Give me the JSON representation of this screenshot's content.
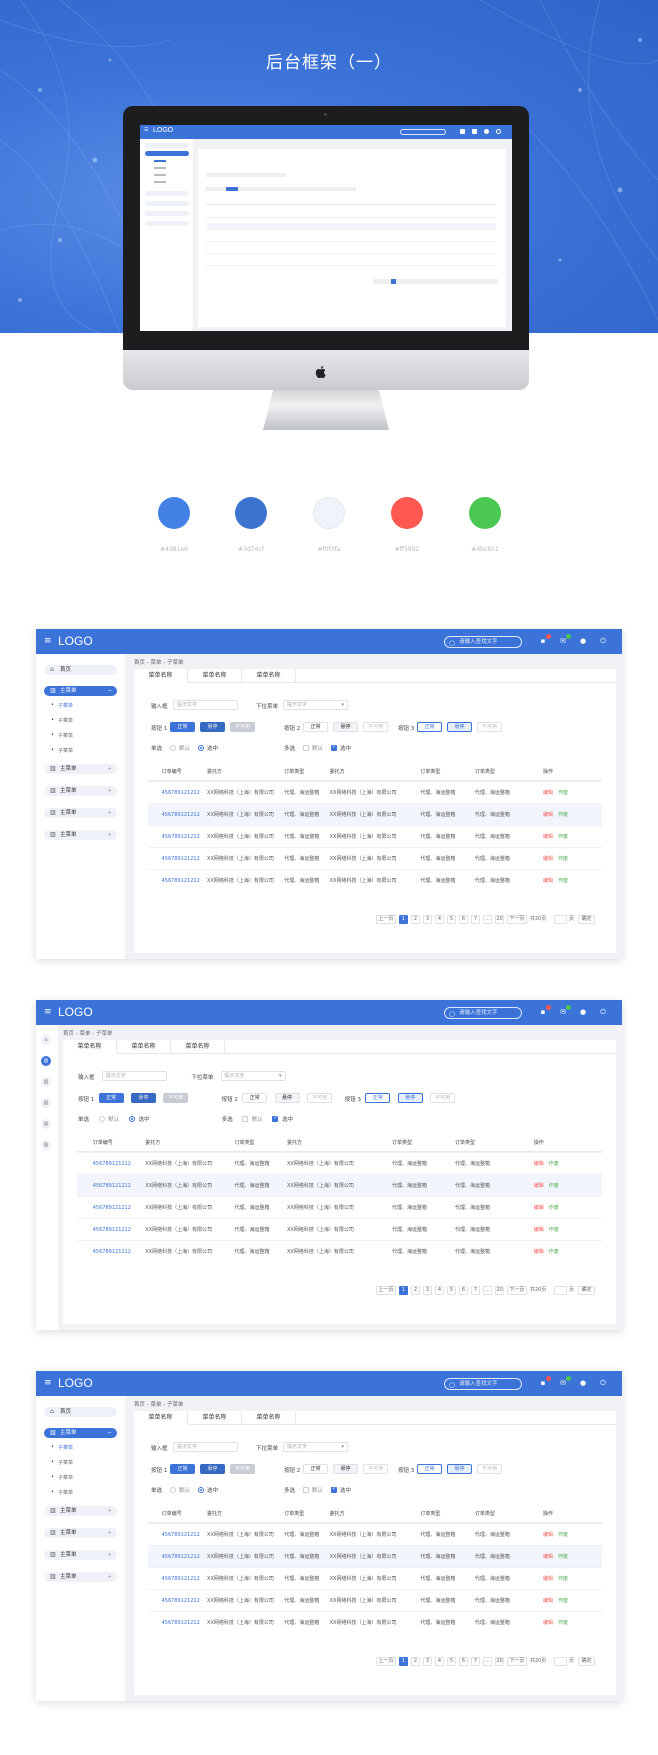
{
  "hero": {
    "title": "后台框架（一）",
    "colors": {
      "bg": "#3d74d9"
    }
  },
  "palette": [
    {
      "hex": "#4381e6",
      "label": "#4381e6"
    },
    {
      "hex": "#3d74cf",
      "label": "#3d74cf"
    },
    {
      "hex": "#f0f3fa",
      "label": "#f0f3fa"
    },
    {
      "hex": "#ff5952",
      "label": "#ff5952"
    },
    {
      "hex": "#4bc851",
      "label": "#4bc851"
    }
  ],
  "app": {
    "logo": "LOGO",
    "search_placeholder": "请输入查找文字",
    "breadcrumb": "首页 - 菜单 - 子菜单",
    "tabs": [
      "菜单名称",
      "菜单名称",
      "菜单名称"
    ],
    "sidebar": {
      "home": "首页",
      "main_active": "主菜单",
      "subs": [
        "子菜单",
        "子菜单",
        "子菜单",
        "子菜单"
      ],
      "mains": [
        "主菜单",
        "主菜单",
        "主菜单",
        "主菜单"
      ]
    },
    "form": {
      "input_label": "输入框",
      "input_placeholder": "提示文字",
      "select_label": "下拉菜单",
      "select_placeholder": "提示文字",
      "btngroup1": "按钮 1",
      "btngroup2": "按钮 2",
      "btngroup3": "按钮 3",
      "btn_normal": "正常",
      "btn_hover": "悬停",
      "btn_disabled": "不可用",
      "radio_label": "单选",
      "check_label": "多选",
      "opt_default": "默认",
      "opt_selected": "选中"
    },
    "table": {
      "headers": [
        "订单编号",
        "委托方",
        "订单类型",
        "委托方",
        "订单类型",
        "订单类型",
        "操作"
      ],
      "rows": [
        [
          "456789121212",
          "XX网络科技（上海）有限公司",
          "代理、海运整箱",
          "XX网络科技（上海）有限公司",
          "代理、海运整箱",
          "代理、海运整箱"
        ],
        [
          "456789121212",
          "XX网络科技（上海）有限公司",
          "代理、海运整箱",
          "XX网络科技（上海）有限公司",
          "代理、海运整箱",
          "代理、海运整箱"
        ],
        [
          "456789121212",
          "XX网络科技（上海）有限公司",
          "代理、海运整箱",
          "XX网络科技（上海）有限公司",
          "代理、海运整箱",
          "代理、海运整箱"
        ],
        [
          "456789121212",
          "XX网络科技（上海）有限公司",
          "代理、海运整箱",
          "XX网络科技（上海）有限公司",
          "代理、海运整箱",
          "代理、海运整箱"
        ],
        [
          "456789121212",
          "XX网络科技（上海）有限公司",
          "代理、海运整箱",
          "XX网络科技（上海）有限公司",
          "代理、海运整箱",
          "代理、海运整箱"
        ]
      ],
      "op_edit": "编辑",
      "op_void": "作废"
    },
    "pager": {
      "prev": "上一页",
      "pages": [
        "1",
        "2",
        "3",
        "4",
        "5",
        "6",
        "7",
        "...",
        "20"
      ],
      "next": "下一页",
      "total": "共20页",
      "goto_unit": "页",
      "confirm": "确定"
    }
  }
}
